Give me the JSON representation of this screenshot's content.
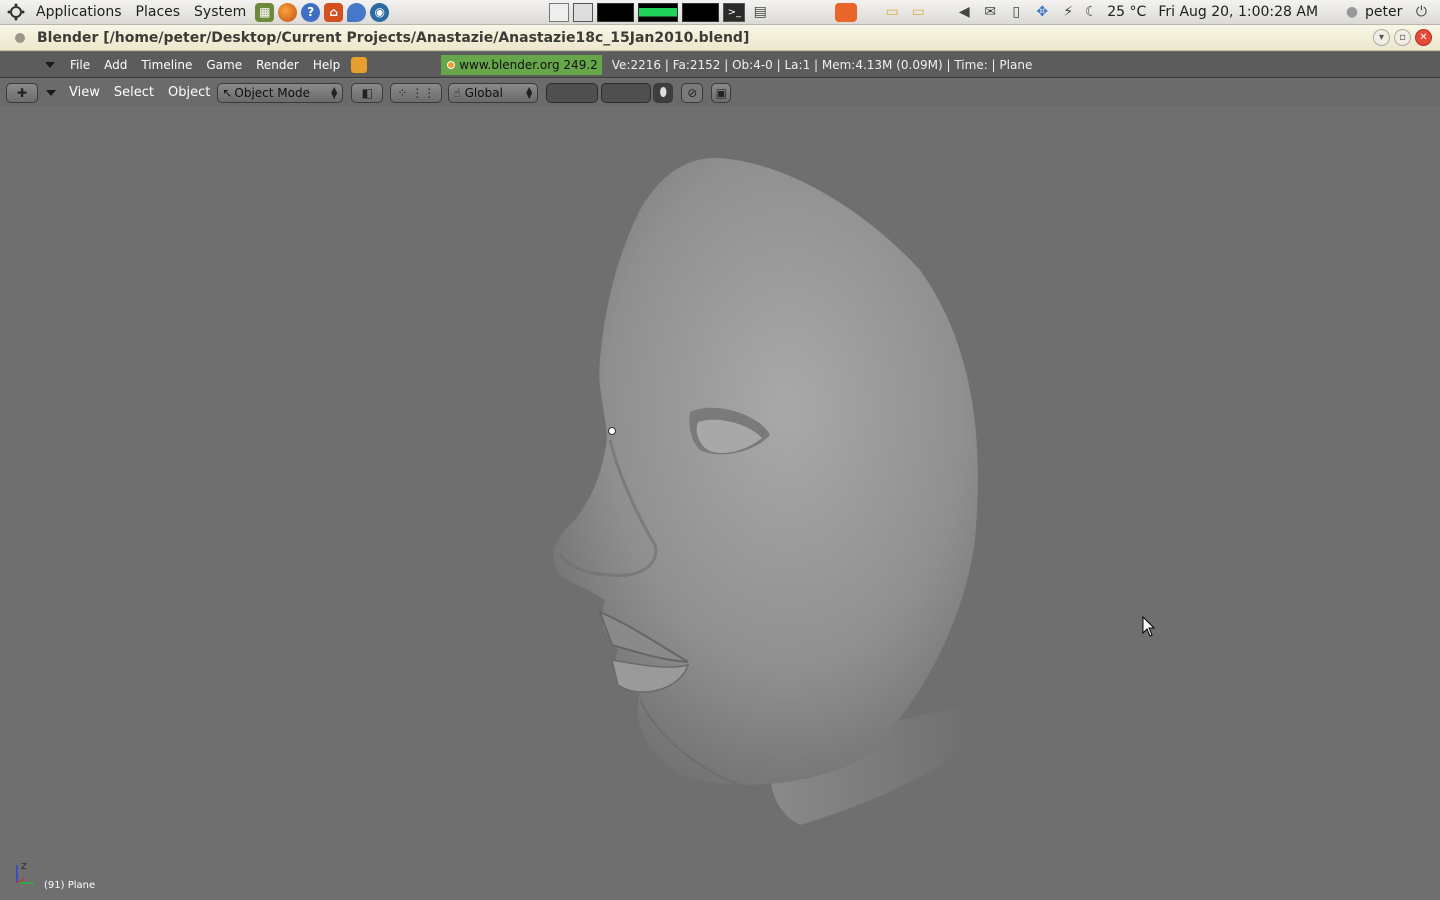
{
  "gnome_panel": {
    "applications": "Applications",
    "places": "Places",
    "system": "System",
    "temperature": "25 °C",
    "datetime": "Fri Aug 20,  1:00:28 AM",
    "user": "peter"
  },
  "window": {
    "title": "Blender [/home/peter/Desktop/Current Projects/Anastazie/Anastazie18c_15Jan2010.blend]"
  },
  "blender_info": {
    "menus": [
      "File",
      "Add",
      "Timeline",
      "Game",
      "Render",
      "Help"
    ],
    "url": "www.blender.org 249.2",
    "stats": "Ve:2216 | Fa:2152 | Ob:4-0 | La:1   | Mem:4.13M (0.09M)  | Time: | Plane"
  },
  "viewport_header": {
    "menus": [
      "View",
      "Select",
      "Object"
    ],
    "mode": "Object Mode",
    "orientation": "Global"
  },
  "viewport": {
    "object_status": "(91) Plane",
    "axis_label": "Z"
  },
  "colors": {
    "viewport_bg": "#6f6f6f",
    "blender_header": "#5c5c5c",
    "url_badge": "#67a64b",
    "window_titlebar": "#f2eed9"
  }
}
